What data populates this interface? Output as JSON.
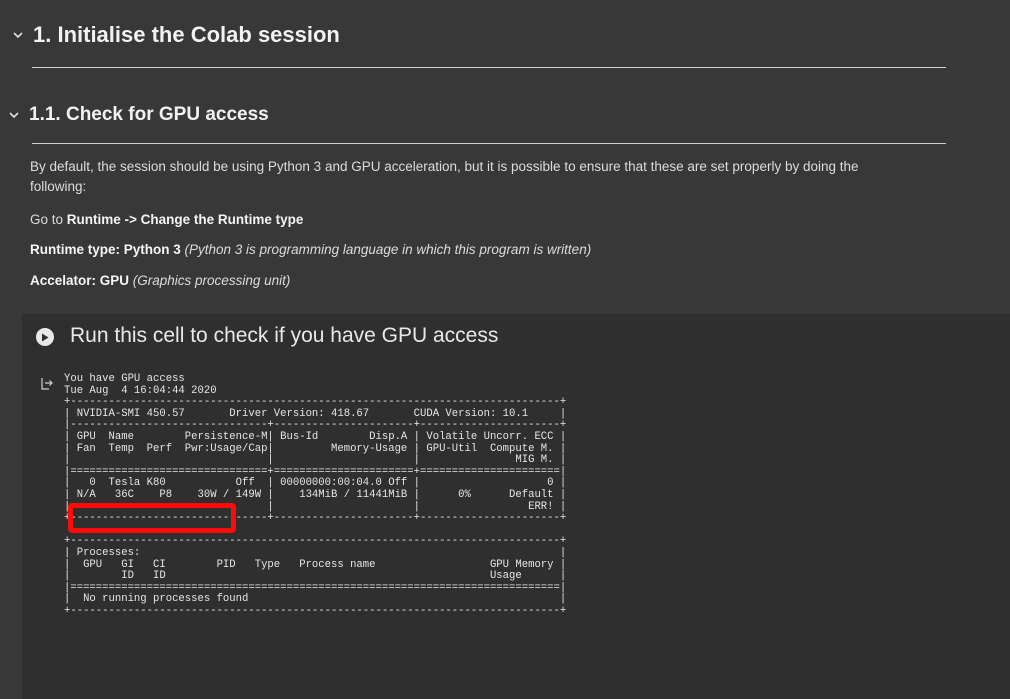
{
  "section1": {
    "title": "1. Initialise the Colab session"
  },
  "section2": {
    "title": "1.1. Check for GPU access",
    "paragraph_line1": "By default, the session should be using Python 3 and GPU acceleration, but it is possible to ensure that these are set properly by doing the",
    "paragraph_line2": "following:",
    "goto_prefix": "Go to ",
    "goto_bold": "Runtime -> Change the Runtime type",
    "runtime_bold": "Runtime type: Python 3",
    "runtime_italic": " (Python 3 is programming language in which this program is written)",
    "accel_bold": "Accelator: GPU",
    "accel_italic": " (Graphics processing unit)"
  },
  "cell": {
    "title": "Run this cell to check if you have GPU access",
    "run_icon": "play-circle-icon",
    "output_icon": "output-redirect-icon"
  },
  "output": {
    "lines": [
      "You have GPU access",
      "Tue Aug  4 16:04:44 2020",
      "+-----------------------------------------------------------------------------+",
      "| NVIDIA-SMI 450.57       Driver Version: 418.67       CUDA Version: 10.1     |",
      "|-------------------------------+----------------------+----------------------+",
      "| GPU  Name        Persistence-M| Bus-Id        Disp.A | Volatile Uncorr. ECC |",
      "| Fan  Temp  Perf  Pwr:Usage/Cap|         Memory-Usage | GPU-Util  Compute M. |",
      "|                               |                      |               MIG M. |",
      "|===============================+======================+======================|",
      "|   0  Tesla K80           Off  | 00000000:00:04.0 Off |                    0 |",
      "| N/A   36C    P8    30W / 149W |    134MiB / 11441MiB |      0%      Default |",
      "|                               |                      |                 ERR! |",
      "+-------------------------------+----------------------+----------------------+",
      "",
      "+-----------------------------------------------------------------------------+",
      "| Processes:                                                                  |",
      "|  GPU   GI   CI        PID   Type   Process name                  GPU Memory |",
      "|        ID   ID                                                   Usage      |",
      "|=============================================================================|",
      "|  No running processes found                                                 |",
      "+-----------------------------------------------------------------------------+"
    ]
  },
  "colors": {
    "background": "#383838",
    "cell_background": "#2f2f2f",
    "highlight": "#ff0a0a"
  }
}
